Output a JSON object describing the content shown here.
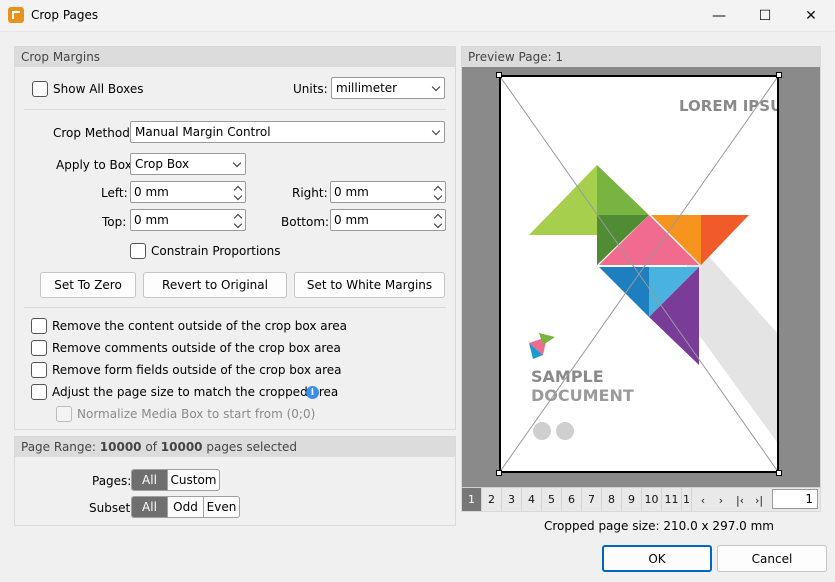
{
  "window": {
    "title": "Crop Pages",
    "minimize_glyph": "—",
    "maximize_glyph": "☐",
    "close_glyph": "✕"
  },
  "crop_margins": {
    "header": "Crop Margins",
    "show_all_boxes_label": "Show All Boxes",
    "show_all_boxes_checked": false,
    "units_label": "Units:",
    "units_value": "millimeter",
    "crop_method_label": "Crop Method:",
    "crop_method_value": "Manual Margin Control",
    "apply_to_box_label": "Apply to Box:",
    "apply_to_box_value": "Crop Box",
    "left_label": "Left:",
    "left_value": "0 mm",
    "right_label": "Right:",
    "right_value": "0 mm",
    "top_label": "Top:",
    "top_value": "0 mm",
    "bottom_label": "Bottom:",
    "bottom_value": "0 mm",
    "constrain_label": "Constrain Proportions",
    "set_to_zero": "Set To Zero",
    "revert_to_original": "Revert to Original",
    "set_to_white_margins": "Set to White Margins",
    "options": [
      {
        "label": "Remove the content outside of the crop box area",
        "checked": false
      },
      {
        "label": "Remove comments outside of the crop box area",
        "checked": false
      },
      {
        "label": "Remove form fields outside of the crop box area",
        "checked": false
      },
      {
        "label": "Adjust the page size to match the cropped area",
        "checked": false
      }
    ],
    "normalize_label": "Normalize Media Box to start from (0;0)",
    "info_glyph": "i"
  },
  "page_range": {
    "header_prefix": "Page Range:",
    "selected_count": "10000",
    "of_text": "of",
    "total_count": "10000",
    "suffix": "pages selected",
    "pages_label": "Pages:",
    "pages_options": [
      "All",
      "Custom"
    ],
    "pages_selected": "All",
    "subset_label": "Subset:",
    "subset_options": [
      "All",
      "Odd",
      "Even"
    ],
    "subset_selected": "All"
  },
  "preview": {
    "header": "Preview Page: 1",
    "page_buttons": [
      "1",
      "2",
      "3",
      "4",
      "5",
      "6",
      "7",
      "8",
      "9",
      "10",
      "11",
      "1"
    ],
    "current_page_button": "1",
    "nav_prev": "‹",
    "nav_next": "›",
    "nav_first": "|‹",
    "nav_last": "›|",
    "page_input_value": "1",
    "cropped_size_text": "Cropped page size: 210.0 x 297.0 mm",
    "document": {
      "title": "LOREM IPSUM",
      "subtitle": "SAMPLE",
      "subtitle2": "DOCUMENT"
    }
  },
  "footer": {
    "ok_label": "OK",
    "cancel_label": "Cancel"
  },
  "colors": {
    "accent": "#0067c0",
    "green": "#8dc63f",
    "dark_green": "#5f9e3a",
    "pink": "#f06b8d",
    "orange": "#f7941d",
    "teal": "#1d9bd1",
    "purple": "#7a3c99"
  }
}
